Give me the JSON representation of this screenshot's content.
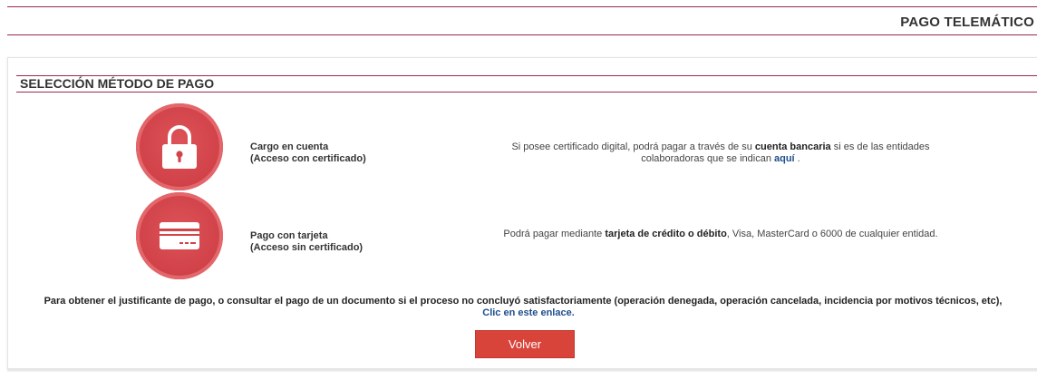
{
  "header": {
    "title": "PAGO TELEMÁTICO"
  },
  "section": {
    "title": "SELECCIÓN MÉTODO DE PAGO"
  },
  "methods": [
    {
      "icon": "padlock-icon",
      "label_line1": "Cargo en cuenta",
      "label_line2": "(Acceso con certificado)",
      "desc_part1": "Si posee certificado digital, podrá pagar a través de su ",
      "desc_bold": "cuenta bancaria",
      "desc_part2": " si es de las entidades",
      "desc_line2": "colaboradoras que se indican ",
      "desc_link": "aquí",
      "desc_end": " ."
    },
    {
      "icon": "credit-card-icon",
      "label_line1": "Pago con tarjeta",
      "label_line2": "(Acceso sin certificado)",
      "desc_part1": "Podrá pagar mediante ",
      "desc_bold": "tarjeta de crédito o débito",
      "desc_part2": ", Visa, MasterCard o 6000 de cualquier entidad."
    }
  ],
  "footer": {
    "note": "Para obtener el justificante de pago, o consultar el pago de un documento si el proceso no concluyó satisfactoriamente (operación denegada, operación cancelada, incidencia por motivos técnicos, etc),",
    "link": "Clic en este enlace."
  },
  "actions": {
    "back_label": "Volver"
  },
  "colors": {
    "accent_line": "#9b2a4e",
    "circle": "#d2434a",
    "button": "#d9443a",
    "link": "#1f4e8c"
  }
}
